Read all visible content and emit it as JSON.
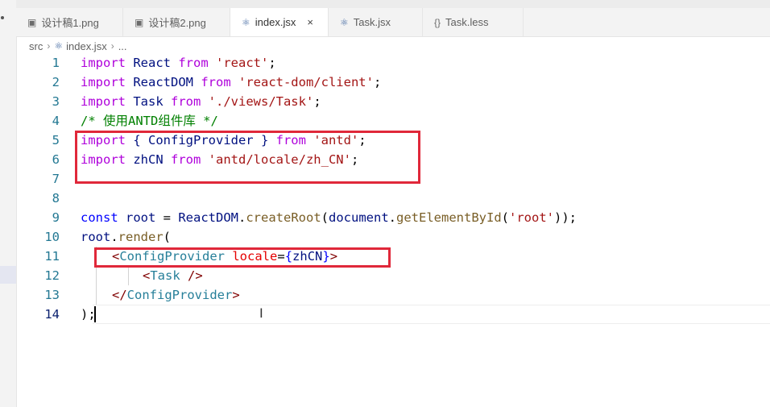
{
  "tabs": [
    {
      "label": "设计稿1.png",
      "icon": "image-icon",
      "active": false
    },
    {
      "label": "设计稿2.png",
      "icon": "image-icon",
      "active": false
    },
    {
      "label": "index.jsx",
      "icon": "react-icon",
      "active": true
    },
    {
      "label": "Task.jsx",
      "icon": "react-icon",
      "active": false
    },
    {
      "label": "Task.less",
      "icon": "braces-icon",
      "active": false
    }
  ],
  "tab_close": "×",
  "breadcrumb": {
    "folder": "src",
    "file": "index.jsx",
    "more": "..."
  },
  "lines": [
    {
      "n": "1"
    },
    {
      "n": "2"
    },
    {
      "n": "3"
    },
    {
      "n": "4"
    },
    {
      "n": "5"
    },
    {
      "n": "6"
    },
    {
      "n": "7"
    },
    {
      "n": "8"
    },
    {
      "n": "9"
    },
    {
      "n": "10"
    },
    {
      "n": "11"
    },
    {
      "n": "12"
    },
    {
      "n": "13"
    },
    {
      "n": "14"
    }
  ],
  "code": {
    "l1": {
      "kw1": "import",
      "id": " React ",
      "kw2": "from",
      "str": " 'react'",
      "end": ";"
    },
    "l2": {
      "kw1": "import",
      "id": " ReactDOM ",
      "kw2": "from",
      "str": " 'react-dom/client'",
      "end": ";"
    },
    "l3": {
      "kw1": "import",
      "id": " Task ",
      "kw2": "from",
      "str": " './views/Task'",
      "end": ";"
    },
    "l4": {
      "cmt": "/* 使用ANTD组件库 */"
    },
    "l5": {
      "kw1": "import",
      "id": " { ConfigProvider } ",
      "kw2": "from",
      "str": " 'antd'",
      "end": ";"
    },
    "l6": {
      "kw1": "import",
      "id": " zhCN ",
      "kw2": "from",
      "str": " 'antd/locale/zh_CN'",
      "end": ";"
    },
    "l9": {
      "decl": "const",
      "var": " root",
      "eq": " = ",
      "obj": "ReactDOM",
      "dot": ".",
      "fn": "createRoot",
      "p1": "(",
      "arg": "document",
      "dot2": ".",
      "fn2": "getElementById",
      "p2": "(",
      "str": "'root'",
      "p3": "));"
    },
    "l10": {
      "var": "root",
      "dot": ".",
      "fn": "render",
      "p": "("
    },
    "l11": {
      "open": "<",
      "tag": "ConfigProvider",
      "sp": " ",
      "attr": "locale",
      "eq": "=",
      "b1": "{",
      "val": "zhCN",
      "b2": "}",
      "close": ">"
    },
    "l12": {
      "open": "<",
      "tag": "Task",
      "close": " />"
    },
    "l13": {
      "open": "</",
      "tag": "ConfigProvider",
      "close": ">"
    },
    "l14": {
      "txt": ");"
    }
  }
}
